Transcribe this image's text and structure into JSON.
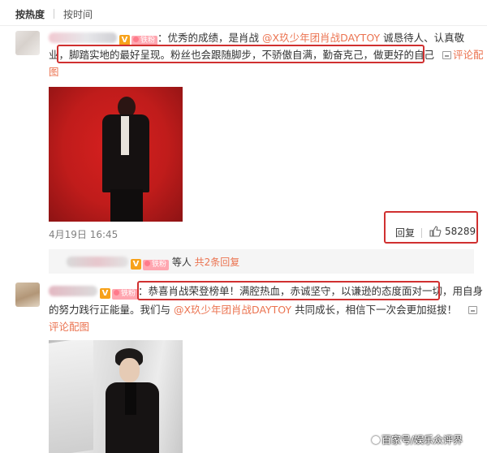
{
  "sort_tabs": {
    "by_heat": "按热度",
    "by_time": "按时间"
  },
  "comment1": {
    "v_badge": "V",
    "iron_fan_badge": "铁粉",
    "text_a": "：优秀的成绩，是肖战 ",
    "mention": "@X玖少年团肖战DAYTOY",
    "text_b": " 诚恳待人、认真敬",
    "line2_a": "业，",
    "line2_b": "脚踏实地的最好呈现。粉丝也会跟随脚步，不骄傲自满，勤奋克己，做更好的自己",
    "comment_on_image_a": "评论配",
    "comment_on_image_b": "图",
    "timestamp": "4月19日 16:45",
    "reply_label": "回复",
    "like_count": "58289",
    "sub_reply_suffix": " 等人 ",
    "sub_reply_count": "共2条回复"
  },
  "comment2": {
    "v_badge": "V",
    "iron_fan_badge": "铁粉",
    "text_a": "：恭喜肖战荣登榜单！满腔热血，赤诚坚守，以谦逊的态度面对一切",
    "text_b": "，用自身",
    "line2_a": "的努力践行正能量。我们与 ",
    "mention": "@X玖少年团肖战DAYTOY",
    "line2_b": " 共同成长，相信下一次会更加挺拔！",
    "comment_on_image": "评论配图"
  },
  "watermark": "百家号/娱乐众评界",
  "colors": {
    "link": "#eb7350",
    "highlight_box": "#d03030",
    "v_badge": "#f7a21b",
    "iron_badge": "#ffa6b0"
  },
  "icons": [
    "reply-image-icon",
    "thumbs-up-icon",
    "verified-v-icon",
    "iron-fan-heart-icon",
    "paw-icon"
  ]
}
